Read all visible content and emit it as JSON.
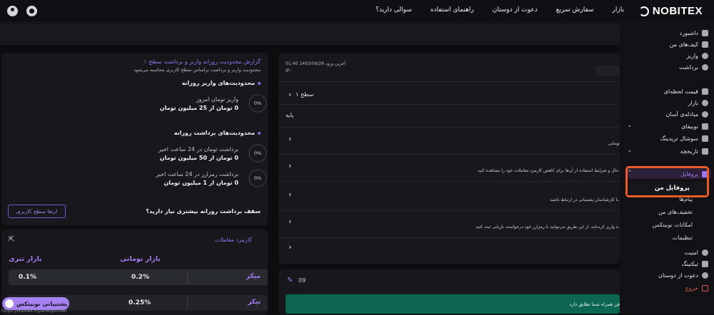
{
  "header": {
    "logo": "NOBITEX",
    "nav": [
      "بازار",
      "سفارش سریع",
      "دعوت از دوستان",
      "راهنمای استفاده",
      "سوالی دارید؟"
    ],
    "icons": [
      "user-icon",
      "gear-icon"
    ]
  },
  "sidebar": {
    "items": [
      {
        "label": "داشبورد",
        "icon": "dashboard-icon"
      },
      {
        "label": "کیف‌های من",
        "icon": "wallet-icon"
      },
      {
        "label": "واریز",
        "icon": "deposit-icon"
      },
      {
        "label": "برداشت",
        "icon": "withdraw-icon"
      },
      {
        "label": "قیمت لحظه‌ای",
        "icon": "price-icon"
      },
      {
        "label": "بازار",
        "icon": "market-icon"
      },
      {
        "label": "مبادله‌ی آسان",
        "icon": "exchange-icon"
      },
      {
        "label": "نوبیفای",
        "icon": "nobify-icon"
      },
      {
        "label": "سوشال تریدینگ",
        "icon": "crown-icon"
      },
      {
        "label": "تاریخچه",
        "icon": "history-icon"
      },
      {
        "label": "پروفایل",
        "icon": "profile-icon"
      },
      {
        "label": "امنیت",
        "icon": "shield-icon"
      },
      {
        "label": "تیکتینگ",
        "icon": "ticket-icon"
      },
      {
        "label": "دعوت از دوستان",
        "icon": "invite-icon"
      },
      {
        "label": "خروج",
        "icon": "logout-icon"
      }
    ],
    "profile_sub": [
      "پروفایل من",
      "پیام‌ها",
      "تخفیف‌های من",
      "امکانات نوبیتکس",
      "تنظیمات"
    ]
  },
  "report": {
    "title": "گزارش محدودیت روزانه واریز و برداشت سطح ۱",
    "subtitle": "محدودیت واریز و برداشت براساس سطح کاربری محاسبه می‌شود",
    "deposit_section": "محدودیت‌های واریز روزانه",
    "deposit_label": "واریز تومان امروز",
    "deposit_value": "0 تومان از 25 میلیون تومان",
    "deposit_percent": "0%",
    "withdraw_section": "محدودیت‌های برداشت روزانه",
    "withdraw_toman_label": "برداشت تومان در 24 ساعت اخیر",
    "withdraw_toman_value": "0 تومان از 50 میلیون تومان",
    "withdraw_toman_percent": "0%",
    "withdraw_crypto_label": "برداشت رمزارز در 24 ساعت اخیر",
    "withdraw_crypto_value": "0 تومان از 1 میلیون تومان",
    "withdraw_crypto_percent": "0%",
    "question": "سقف برداشت روزانه بیشتری نیاز دارید؟",
    "upgrade_button": "ارتقا سطح کاربری"
  },
  "fees": {
    "title": "کارمزد معاملات",
    "col_toman": "بازار تومانی",
    "col_tether": "بازار تتری",
    "rows": [
      {
        "label": "میکر",
        "toman": "0.2%",
        "tether": "0.1%"
      },
      {
        "label": "تیکر",
        "toman": "0.25%",
        "tether": ""
      }
    ]
  },
  "level_panel": {
    "last_login": "آخرین ورود 1403/09/26 01:40",
    "ip": "IP:",
    "level": "سطح ۱",
    "base": "پایه",
    "rows": [
      "",
      "تومانی",
      "عال و شرایط استفاده از آن‌ها برای کاهش کارمزد معاملات خود را مشاهده کنید.",
      "با کارشناسان پشتیبانی در ارتباط باشید.",
      "ه واریز کرده‌اید، از این طریق می‌توانید با رمزارز خود درخواست بازیابی ثبت کنید.",
      ""
    ]
  },
  "bottom_panel": {
    "count": "09",
    "banner_text": "فن همراه شما تطابق دارد"
  },
  "support": {
    "label": "پشتیبانی نوبیتکس",
    "url": "https://nobitex.ir/panel/profile/"
  }
}
